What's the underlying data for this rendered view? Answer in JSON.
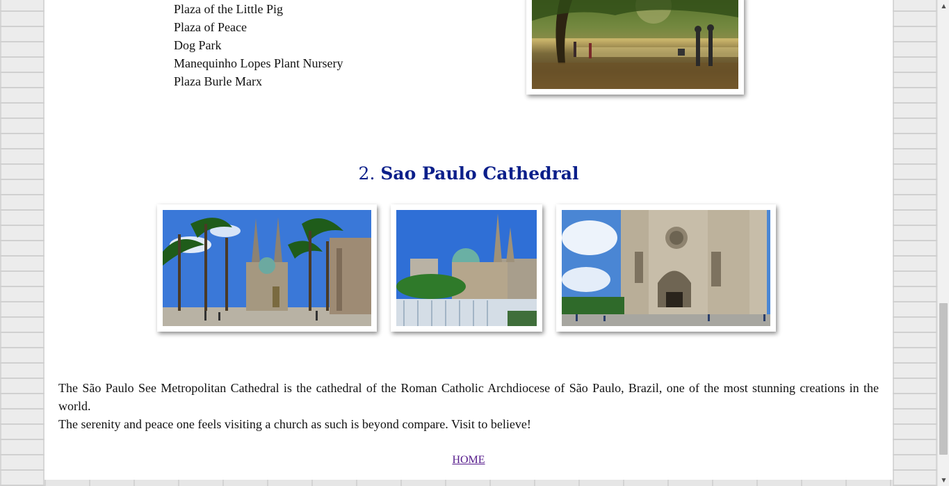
{
  "park_list": {
    "items": [
      "Plaza of the Little Pig",
      "Plaza of Peace",
      "Dog Park",
      "Manequinho Lopes Plant Nursery",
      "Plaza Burle Marx"
    ]
  },
  "section": {
    "number": "2.",
    "title": "Sao Paulo Cathedral"
  },
  "description": {
    "p1": "The São Paulo See Metropolitan Cathedral is the cathedral of the Roman Catholic Archdiocese of São Paulo, Brazil, one of the most stunning creations in the world.",
    "p2": "The serenity and peace one feels visiting a church as such is beyond compare. Visit to believe!"
  },
  "footer": {
    "home_label": "HOME"
  }
}
